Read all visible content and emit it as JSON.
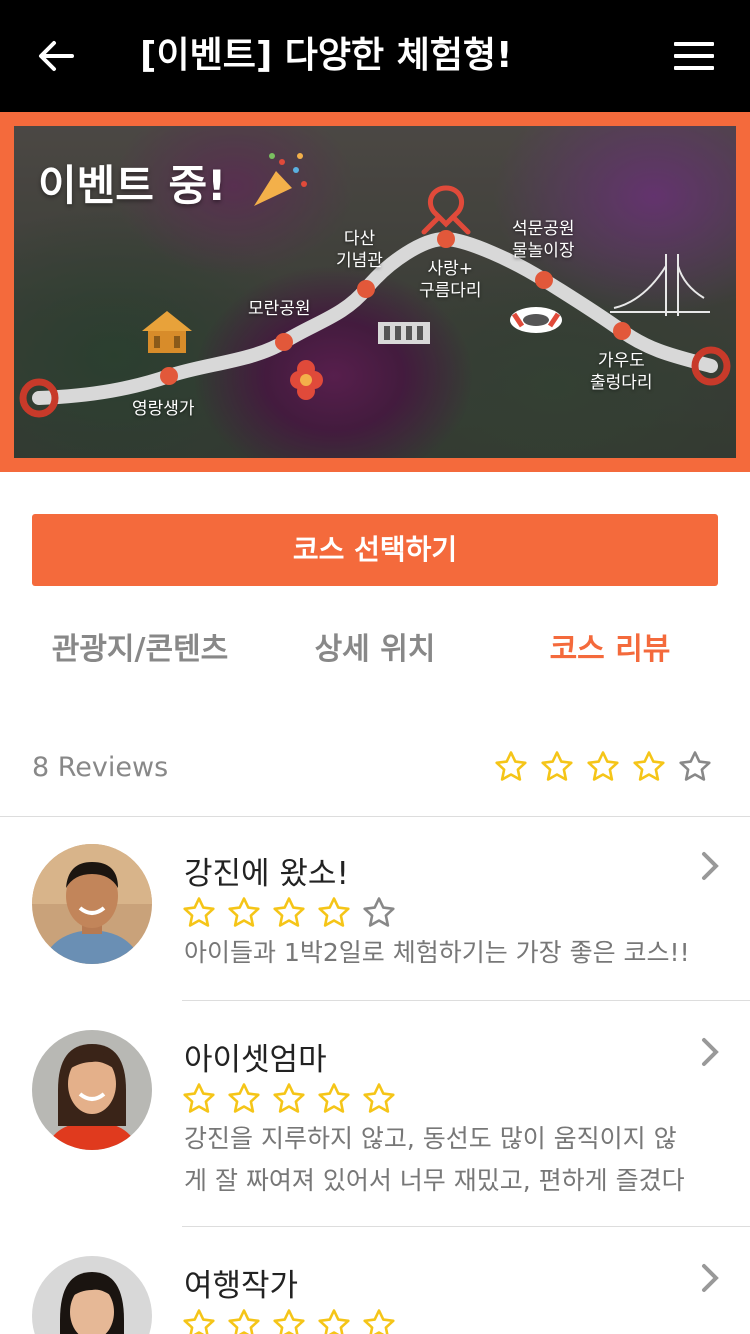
{
  "header": {
    "title": "[이벤트] 다양한 체험형!"
  },
  "banner": {
    "event_label": "이벤트 중!",
    "spots": [
      {
        "line1": "영랑생가",
        "line2": ""
      },
      {
        "line1": "모란공원",
        "line2": ""
      },
      {
        "line1": "다산",
        "line2": "기념관"
      },
      {
        "line1": "사랑+",
        "line2": "구름다리"
      },
      {
        "line1": "석문공원",
        "line2": "물놀이장"
      },
      {
        "line1": "가우도",
        "line2": "출렁다리"
      }
    ]
  },
  "select_button": {
    "label": "코스 선택하기"
  },
  "tabs": [
    {
      "label": "관광지/콘텐츠",
      "active": false
    },
    {
      "label": "상세 위치",
      "active": false
    },
    {
      "label": "코스 리뷰",
      "active": true
    }
  ],
  "review_summary": {
    "count_label": "8 Reviews",
    "rating": 4,
    "max_rating": 5
  },
  "reviews": [
    {
      "name": "강진에 왔소!",
      "rating": 4,
      "lines": [
        "아이들과 1박2일로 체험하기는 가장 좋은 코스!!"
      ]
    },
    {
      "name": "아이셋엄마",
      "rating": 5,
      "lines": [
        "강진을 지루하지 않고, 동선도 많이 움직이지 않",
        "게 잘 짜여져 있어서 너무 재밌고, 편하게 즐겼다"
      ]
    },
    {
      "name": "여행작가",
      "rating": 5,
      "lines": []
    }
  ],
  "colors": {
    "accent": "#f46a3c",
    "star_fill": "#f5c518",
    "star_empty": "#888888",
    "header_bg": "#000000"
  },
  "icons": {
    "back": "arrow-left-icon",
    "menu": "hamburger-menu-icon",
    "star": "star-icon",
    "chevron": "chevron-right-icon"
  }
}
